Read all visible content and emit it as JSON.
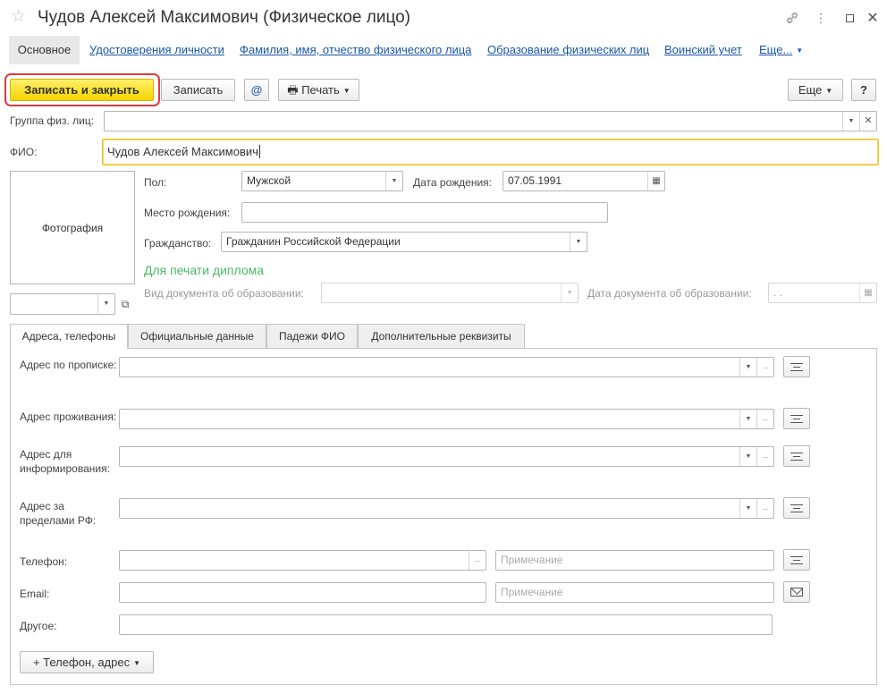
{
  "window": {
    "title": "Чудов Алексей Максимович (Физическое лицо)",
    "icons": [
      "star-icon",
      "link-icon",
      "more-icon",
      "maximize-icon",
      "close-icon"
    ]
  },
  "nav": {
    "active": "Основное",
    "links": [
      "Удостоверения личности",
      "Фамилия, имя, отчество физического лица",
      "Образование физических лиц",
      "Воинский учет",
      "Еще..."
    ]
  },
  "toolbar": {
    "save_close": "Записать и закрыть",
    "save": "Записать",
    "email_symbol": "@",
    "print": "Печать",
    "more": "Еще",
    "help": "?"
  },
  "form": {
    "group_label": "Группа физ. лиц:",
    "group_value": "",
    "fio_label": "ФИО:",
    "fio_value": "Чудов Алексей Максимович",
    "photo_label": "Фотография",
    "gender_label": "Пол:",
    "gender_value": "Мужской",
    "birthdate_label": "Дата рождения:",
    "birthdate_value": "07.05.1991",
    "birthplace_label": "Место рождения:",
    "birthplace_value": "",
    "citizenship_label": "Гражданство:",
    "citizenship_value": "Гражданин Российской Федерации",
    "diploma_heading": "Для печати диплома",
    "edu_doc_type_label": "Вид документа об образовании:",
    "edu_doc_date_label": "Дата документа об образовании:",
    "edu_doc_date_value": " .  .  "
  },
  "tabs": [
    "Адреса, телефоны",
    "Официальные данные",
    "Падежи ФИО",
    "Дополнительные реквизиты"
  ],
  "contacts": {
    "addr_reg": "Адрес по прописке:",
    "addr_live": "Адрес проживания:",
    "addr_info": "Адрес для информирования:",
    "addr_abroad": "Адрес за пределами РФ:",
    "phone_label": "Телефон:",
    "email_label": "Email:",
    "other_label": "Другое:",
    "note_placeholder": "Примечание",
    "ellipsis": "...",
    "add_button": "+ Телефон, адрес"
  },
  "colors": {
    "accent_yellow": "#f4d400",
    "focus_ring": "#e03c3c",
    "link_blue": "#1a57a6",
    "green_heading": "#49b86b"
  }
}
